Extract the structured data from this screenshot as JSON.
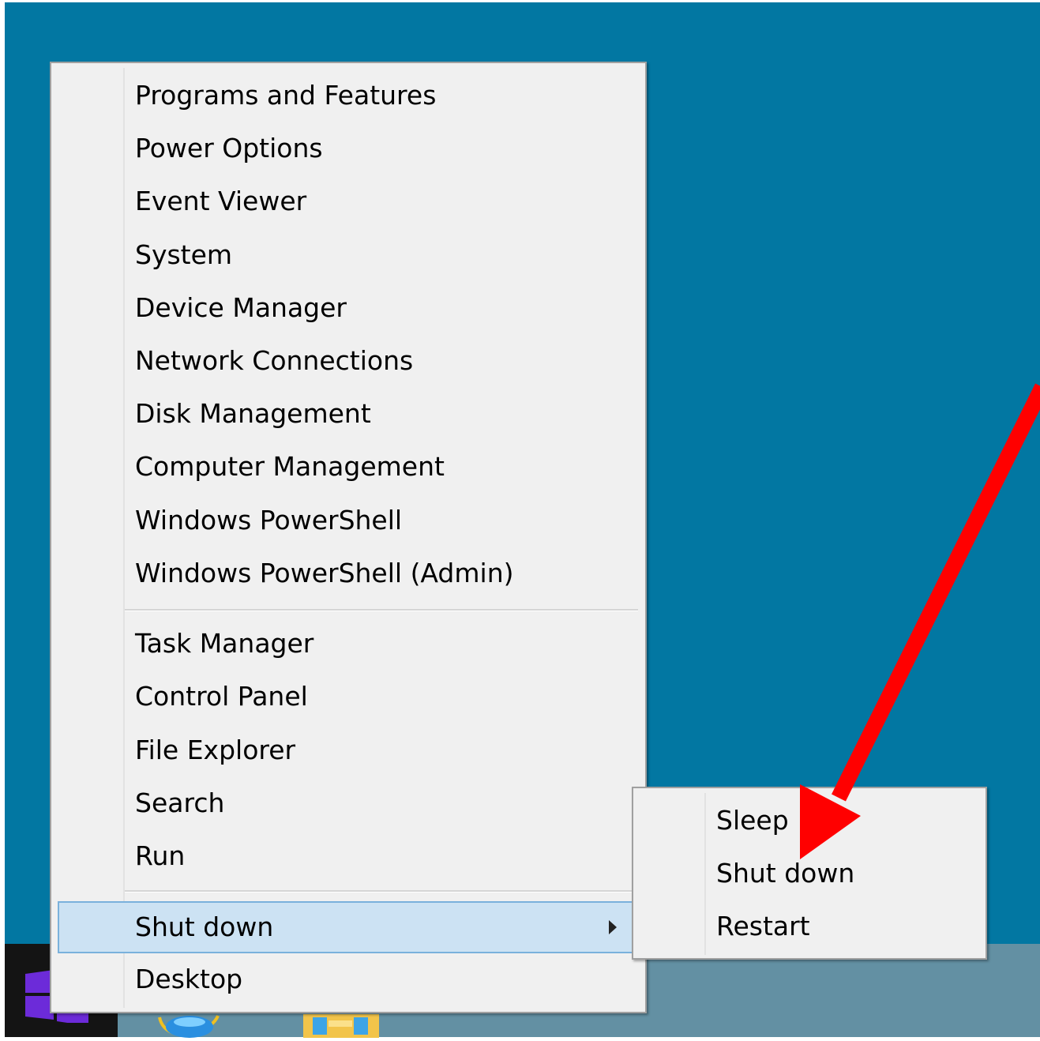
{
  "menu": {
    "items": [
      {
        "label": "Programs and Features"
      },
      {
        "label": "Power Options"
      },
      {
        "label": "Event Viewer"
      },
      {
        "label": "System"
      },
      {
        "label": "Device Manager"
      },
      {
        "label": "Network Connections"
      },
      {
        "label": "Disk Management"
      },
      {
        "label": "Computer Management"
      },
      {
        "label": "Windows PowerShell"
      },
      {
        "label": "Windows PowerShell (Admin)"
      },
      {
        "label": "Task Manager"
      },
      {
        "label": "Control Panel"
      },
      {
        "label": "File Explorer"
      },
      {
        "label": "Search"
      },
      {
        "label": "Run"
      },
      {
        "label": "Shut down",
        "has_submenu": true,
        "highlighted": true
      },
      {
        "label": "Desktop"
      }
    ]
  },
  "submenu": {
    "items": [
      {
        "label": "Sleep"
      },
      {
        "label": "Shut down"
      },
      {
        "label": "Restart"
      }
    ]
  },
  "annotation": {
    "arrow_color": "#ff0000",
    "points_to": "Shut down"
  },
  "colors": {
    "desktop": "#0277a2",
    "menu_background": "#f0f0f0",
    "highlight": "#cce2f3",
    "highlight_border": "#7ab1dc"
  },
  "taskbar": {
    "icons": [
      "windows-start-icon",
      "internet-explorer-icon",
      "file-explorer-icon"
    ]
  }
}
